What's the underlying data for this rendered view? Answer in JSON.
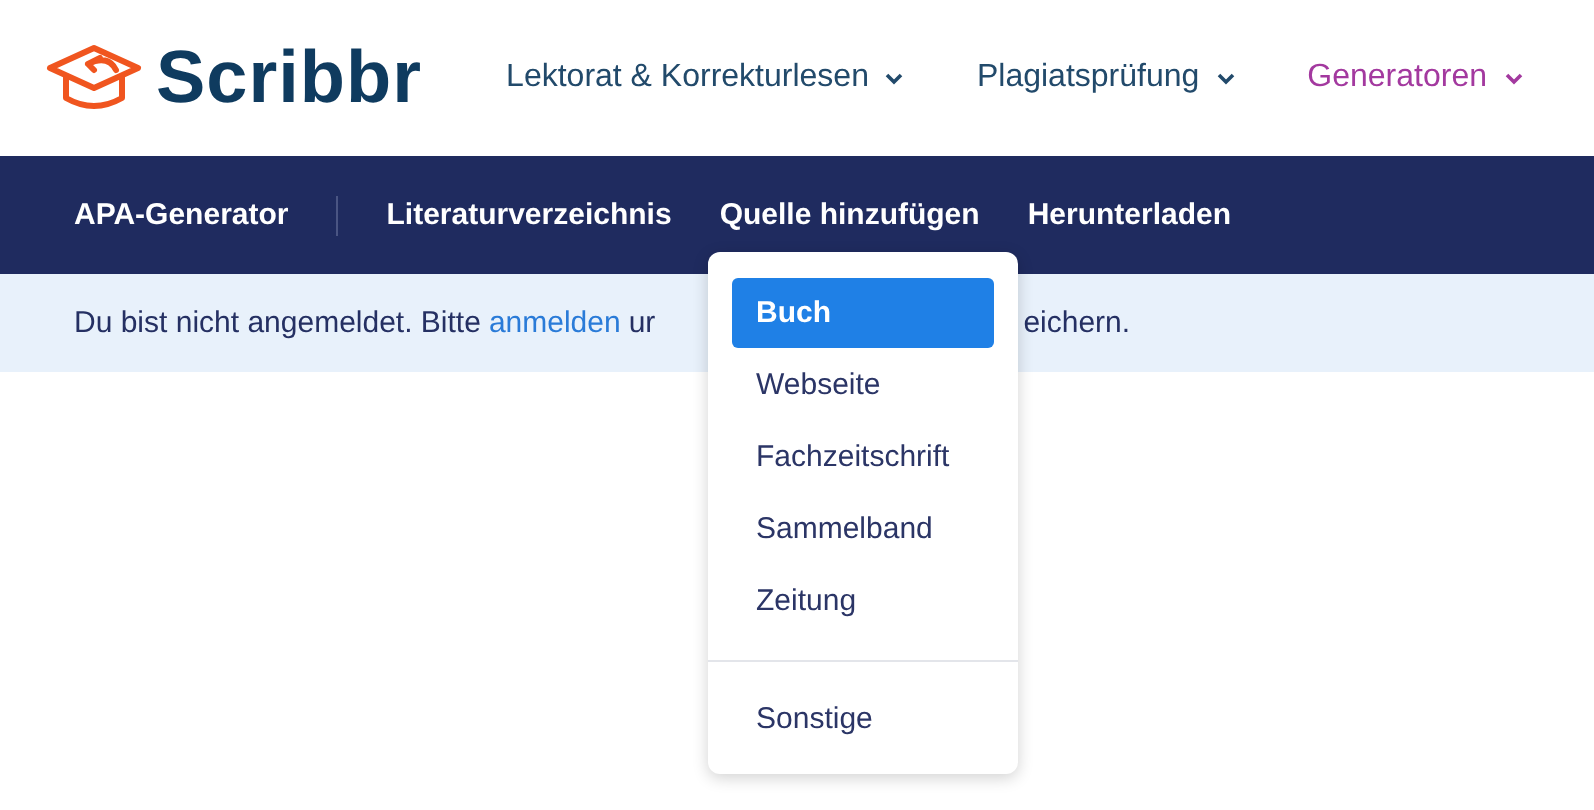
{
  "logo": {
    "text": "Scribbr"
  },
  "main_nav": [
    {
      "label": "Lektorat & Korrekturlesen",
      "selected": false
    },
    {
      "label": "Plagiatsprüfung",
      "selected": false
    },
    {
      "label": "Generatoren",
      "selected": true
    }
  ],
  "tool_nav": {
    "title": "APA-Generator",
    "items": [
      {
        "label": "Literaturverzeichnis"
      },
      {
        "label": "Quelle hinzufügen"
      },
      {
        "label": "Herunterladen"
      }
    ]
  },
  "notice": {
    "text": "Du bist nicht angemeldet. Bitte",
    "link": "anmelden",
    "hidden_part_start": "ur",
    "hidden_part_end": "eichern."
  },
  "dropdown": {
    "groups": [
      [
        {
          "label": "Buch",
          "selected": true
        },
        {
          "label": "Webseite",
          "selected": false
        },
        {
          "label": "Fachzeitschrift",
          "selected": false
        },
        {
          "label": "Sammelband",
          "selected": false
        },
        {
          "label": "Zeitung",
          "selected": false
        }
      ],
      [
        {
          "label": "Sonstige",
          "selected": false
        }
      ]
    ]
  }
}
